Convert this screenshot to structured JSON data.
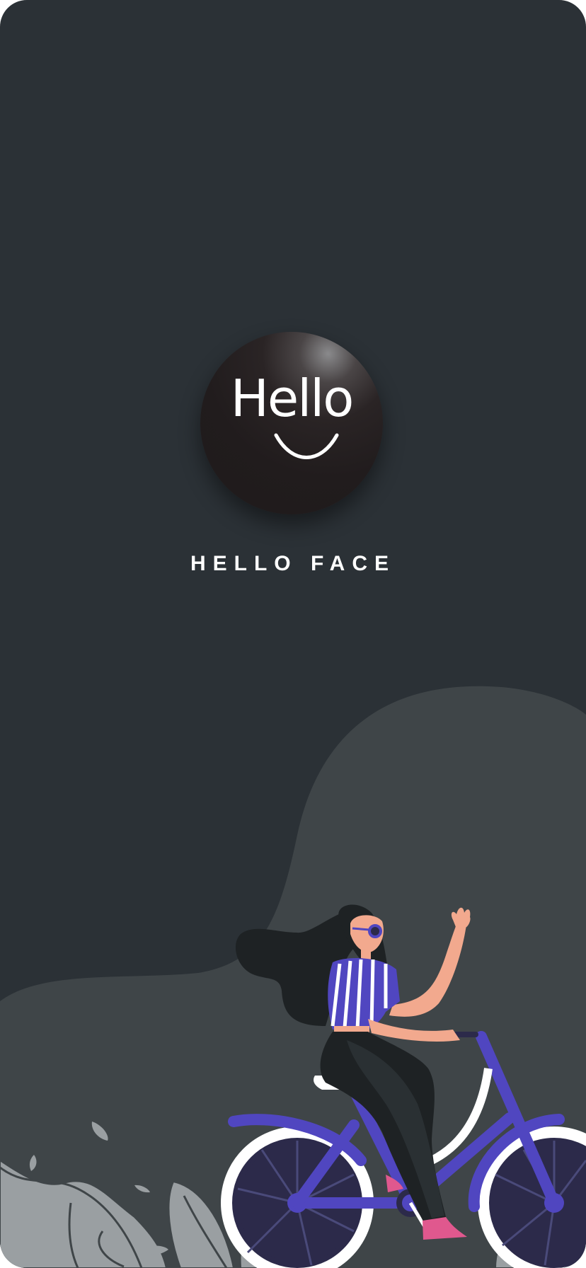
{
  "logo": {
    "wordmark": "Hello"
  },
  "app": {
    "name": "HELLO FACE"
  },
  "colors": {
    "background": "#2b3136",
    "hill": "#3f4548",
    "logo_circle": "#211c1d",
    "accent_bike": "#5046c0",
    "text": "#ffffff"
  },
  "illustration": {
    "subject": "woman-riding-bicycle-icon"
  }
}
